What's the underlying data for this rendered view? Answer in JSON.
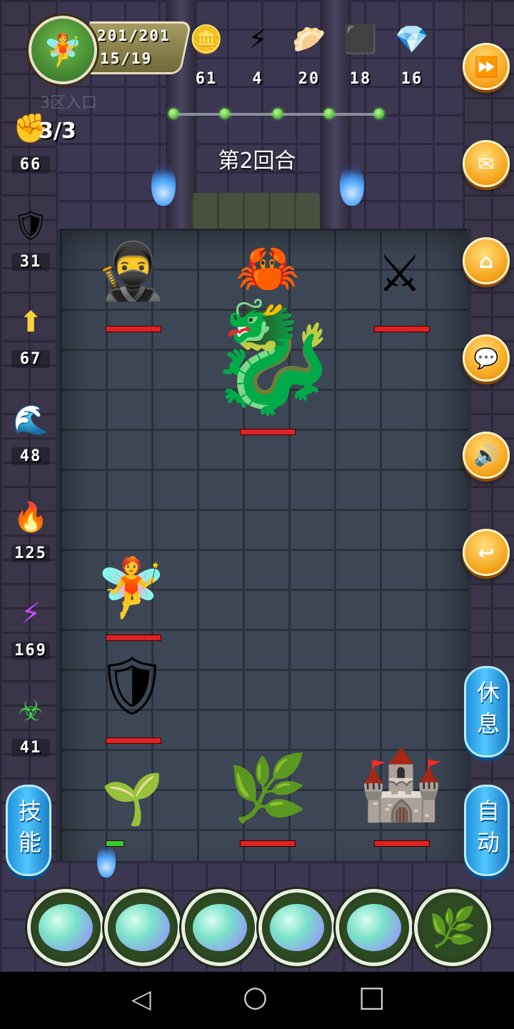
{
  "player": {
    "hp": "201/201",
    "level": "15/19"
  },
  "resources": [
    {
      "icon": "gold-coin-icon",
      "glyph": "🪙",
      "value": "61"
    },
    {
      "icon": "lightning-icon",
      "glyph": "⚡",
      "value": "4"
    },
    {
      "icon": "bun-icon",
      "glyph": "🥟",
      "value": "20"
    },
    {
      "icon": "ore-icon",
      "glyph": "⬛",
      "value": "18"
    },
    {
      "icon": "crystal-icon",
      "glyph": "💎",
      "value": "16"
    }
  ],
  "faint_text": "3区入口",
  "round_label": "第2回合",
  "fist": {
    "icon": "fist-icon",
    "count": "3/3"
  },
  "stats": [
    {
      "icon": "fist-icon",
      "glyph": "✊",
      "value": "66"
    },
    {
      "icon": "shield-icon",
      "glyph": "🛡",
      "value": "31"
    },
    {
      "icon": "arrow-up-icon",
      "glyph": "⬆",
      "value": "67"
    },
    {
      "icon": "water-icon",
      "glyph": "🌊",
      "value": "48"
    },
    {
      "icon": "fire-icon",
      "glyph": "🔥",
      "value": "125"
    },
    {
      "icon": "lightning-icon",
      "glyph": "⚡",
      "value": "169"
    },
    {
      "icon": "poison-icon",
      "glyph": "☣",
      "value": "41"
    }
  ],
  "right_buttons": [
    {
      "name": "fast-forward-button",
      "icon": "fast-forward-icon",
      "glyph": "⏩"
    },
    {
      "name": "mail-button",
      "icon": "mail-icon",
      "glyph": "✉"
    },
    {
      "name": "home-button",
      "icon": "home-icon",
      "glyph": "⌂"
    },
    {
      "name": "chat-button",
      "icon": "chat-icon",
      "glyph": "💬"
    },
    {
      "name": "sound-button",
      "icon": "speaker-icon",
      "glyph": "🔊"
    },
    {
      "name": "back-button",
      "icon": "return-icon",
      "glyph": "↩"
    }
  ],
  "rest_button": "休息",
  "auto_button": "自动",
  "skill_button": "技能",
  "enemies": [
    {
      "name": "ninja",
      "glyph": "🥷"
    },
    {
      "name": "masked-crab-warrior",
      "glyph": "🦀"
    },
    {
      "name": "samurai",
      "glyph": "⚔"
    },
    {
      "name": "blue-dragon",
      "glyph": "🐉"
    }
  ],
  "allies": [
    {
      "name": "forest-fairy",
      "glyph": "🧚"
    },
    {
      "name": "knight",
      "glyph": "🛡"
    },
    {
      "name": "sprout",
      "glyph": "🌱"
    },
    {
      "name": "thorn-vine",
      "glyph": "🌿"
    },
    {
      "name": "stone-tower",
      "glyph": "🏰"
    }
  ],
  "slots": [
    {
      "icon": "egg-icon"
    },
    {
      "icon": "egg-icon"
    },
    {
      "icon": "egg-icon"
    },
    {
      "icon": "egg-icon"
    },
    {
      "icon": "egg-icon"
    },
    {
      "icon": "sapling-icon",
      "glyph": "🌿"
    }
  ],
  "nav": {
    "back": "◁",
    "home": "○",
    "recent": "□"
  }
}
